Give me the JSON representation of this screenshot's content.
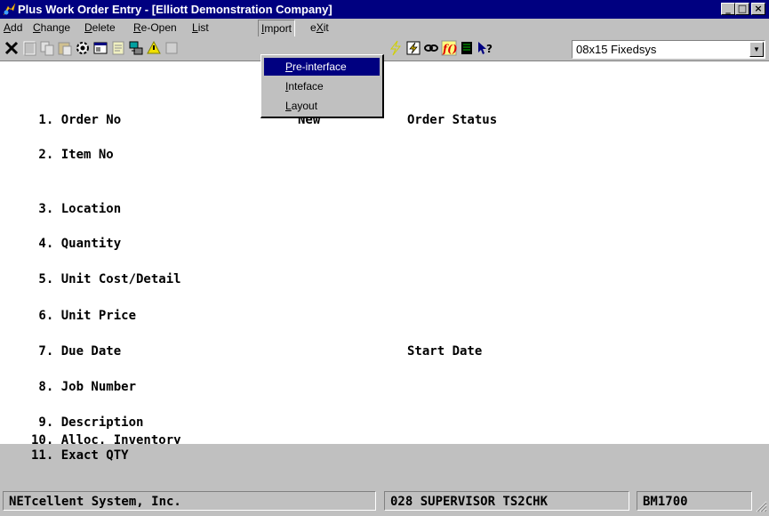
{
  "window": {
    "title": "Plus Work Order Entry - [Elliott Demonstration Company]",
    "title_bar_color": "#000080",
    "controls": {
      "minimize": "_",
      "maximize": "□",
      "close": "×"
    }
  },
  "menu": {
    "items": [
      {
        "pre": "",
        "key": "A",
        "post": "dd"
      },
      {
        "pre": "",
        "key": "C",
        "post": "hange"
      },
      {
        "pre": "",
        "key": "D",
        "post": "elete"
      },
      {
        "pre": "",
        "key": "R",
        "post": "e-Open"
      },
      {
        "pre": "",
        "key": "L",
        "post": "ist"
      },
      {
        "pre": "",
        "key": "I",
        "post": "mport"
      },
      {
        "pre": "e",
        "key": "X",
        "post": "it"
      }
    ],
    "import_dropdown": [
      {
        "pre": "",
        "key": "P",
        "post": "re-interface",
        "selected": true
      },
      {
        "pre": "",
        "key": "I",
        "post": "nteface",
        "selected": false
      },
      {
        "pre": "",
        "key": "L",
        "post": "ayout",
        "selected": false
      }
    ]
  },
  "toolbar": {
    "icons": [
      "close-x-icon",
      "blank-icon",
      "copy-icon",
      "paste-icon",
      "gear-icon",
      "properties-icon",
      "notes-icon",
      "network-icon",
      "warning-icon",
      "lightning-icon",
      "calculator-icon",
      "link-icon",
      "function-icon",
      "document-icon",
      "help-pointer-icon"
    ],
    "font_select": {
      "value": "08x15 Fixedsys"
    }
  },
  "form": {
    "fields": [
      {
        "label": " 1. Order No"
      },
      {
        "label": " 2. Item No"
      },
      {
        "label": " 3. Location"
      },
      {
        "label": " 4. Quantity"
      },
      {
        "label": " 5. Unit Cost/Detail"
      },
      {
        "label": " 6. Unit Price"
      },
      {
        "label": " 7. Due Date"
      },
      {
        "label": " 8. Job Number"
      },
      {
        "label": " 9. Description"
      },
      {
        "label": "10. Alloc. Inventory"
      },
      {
        "label": "11. Exact QTY"
      }
    ],
    "order_no_value": "New",
    "order_status_label": "Order Status",
    "start_date_label": "Start Date"
  },
  "status_bar": {
    "company": "NETcellent System, Inc.",
    "user": "028 SUPERVISOR TS2CHK",
    "program": "BM1700"
  }
}
